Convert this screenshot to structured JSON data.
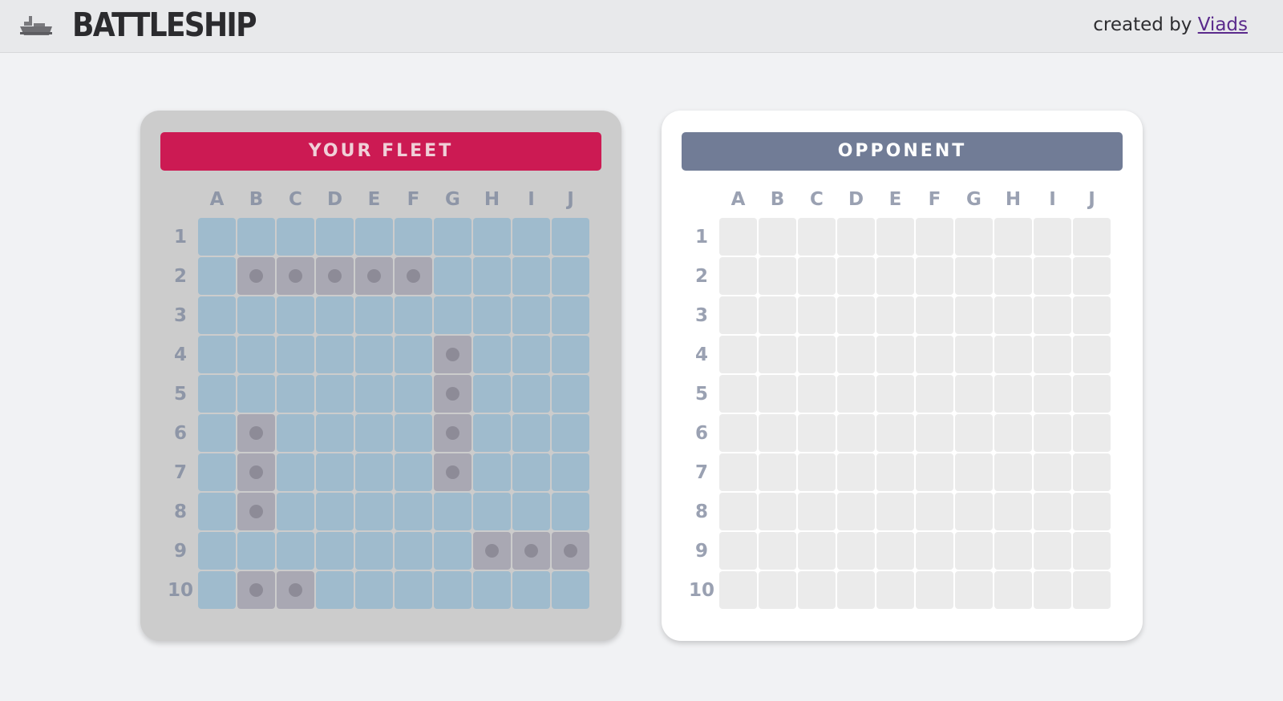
{
  "header": {
    "title": "BATTLESHIP",
    "logo_icon": "ship-icon",
    "credit_prefix": "created by",
    "credit_link": "Viads"
  },
  "boards": {
    "fleet": {
      "title": "YOUR FLEET",
      "ship_cells": [
        "B2",
        "C2",
        "D2",
        "E2",
        "F2",
        "G4",
        "G5",
        "G6",
        "G7",
        "B6",
        "B7",
        "B8",
        "H9",
        "I9",
        "J9",
        "B10",
        "C10"
      ]
    },
    "opponent": {
      "title": "OPPONENT"
    },
    "columns": [
      "A",
      "B",
      "C",
      "D",
      "E",
      "F",
      "G",
      "H",
      "I",
      "J"
    ],
    "rows": [
      "1",
      "2",
      "3",
      "4",
      "5",
      "6",
      "7",
      "8",
      "9",
      "10"
    ]
  },
  "colors": {
    "fleet_header": "#cc1a53",
    "opponent_header": "#717c96",
    "water": "#9fbbcd",
    "ship": "#a9a8b3",
    "empty_cell": "#ebebeb"
  }
}
